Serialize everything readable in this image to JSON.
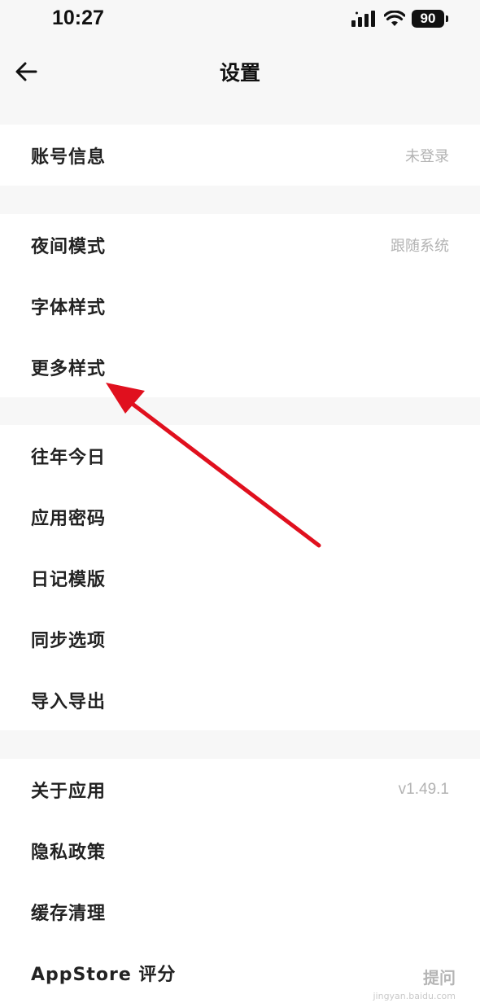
{
  "status_bar": {
    "time": "10:27",
    "battery": "90",
    "icons": [
      "signal-icon",
      "wifi-icon",
      "battery-icon"
    ]
  },
  "nav": {
    "title": "设置",
    "back_icon": "back-arrow-icon"
  },
  "sections": [
    {
      "items": [
        {
          "label": "账号信息",
          "value": "未登录"
        }
      ]
    },
    {
      "items": [
        {
          "label": "夜间模式",
          "value": "跟随系统"
        },
        {
          "label": "字体样式"
        },
        {
          "label": "更多样式"
        }
      ]
    },
    {
      "items": [
        {
          "label": "往年今日"
        },
        {
          "label": "应用密码"
        },
        {
          "label": "日记模版"
        },
        {
          "label": "同步选项"
        },
        {
          "label": "导入导出"
        }
      ]
    },
    {
      "items": [
        {
          "label": "关于应用",
          "value": "v1.49.1"
        },
        {
          "label": "隐私政策"
        },
        {
          "label": "缓存清理"
        },
        {
          "label": "AppStore 评分"
        }
      ]
    }
  ],
  "annotation": {
    "arrow_color": "#e0101e",
    "points_to": "更多样式"
  },
  "watermark": {
    "text": "提问",
    "sub": "jingyan.baidu.com"
  }
}
